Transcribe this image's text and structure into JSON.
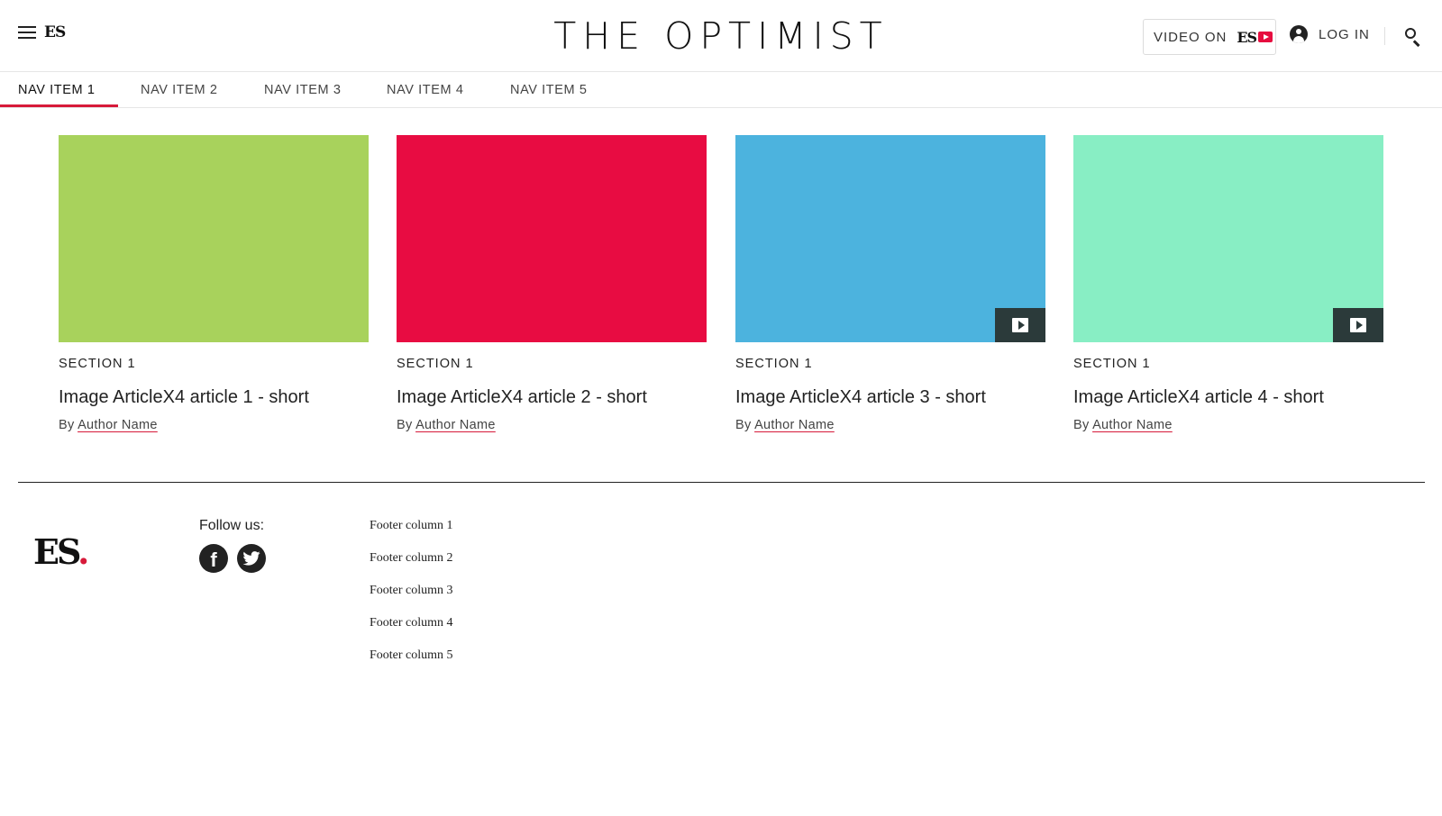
{
  "header": {
    "menu_logo": "ES",
    "site_title": "THE OPTIMIST",
    "video_button": {
      "label": "VIDEO ON",
      "logo": "ES"
    },
    "login_label": "LOG IN",
    "icons": [
      "menu-icon",
      "user-icon",
      "search-icon",
      "play-icon"
    ]
  },
  "nav": {
    "items": [
      "NAV ITEM 1",
      "NAV ITEM 2",
      "NAV ITEM 3",
      "NAV ITEM 4",
      "NAV ITEM 5"
    ],
    "active_index": 0,
    "accent_color": "#d71a3a"
  },
  "articles": [
    {
      "section": "SECTION 1",
      "headline": "Image ArticleX4 article 1 - short",
      "by": "By",
      "author": "Author Name",
      "image_color": "#a8d25c",
      "has_video": false
    },
    {
      "section": "SECTION 1",
      "headline": "Image ArticleX4 article 2 - short",
      "by": "By",
      "author": "Author Name",
      "image_color": "#e80c42",
      "has_video": false
    },
    {
      "section": "SECTION 1",
      "headline": "Image ArticleX4 article 3 - short",
      "by": "By",
      "author": "Author Name",
      "image_color": "#4cb3de",
      "has_video": true
    },
    {
      "section": "SECTION 1",
      "headline": "Image ArticleX4 article 4 - short",
      "by": "By",
      "author": "Author Name",
      "image_color": "#88eec4",
      "has_video": true
    }
  ],
  "footer": {
    "logo": "ES",
    "logo_dot": ".",
    "follow_label": "Follow us:",
    "social": [
      "facebook-icon",
      "twitter-icon"
    ],
    "facebook_glyph": "f",
    "columns": [
      "Footer column 1",
      "Footer column 2",
      "Footer column 3",
      "Footer column 4",
      "Footer column 5"
    ]
  }
}
